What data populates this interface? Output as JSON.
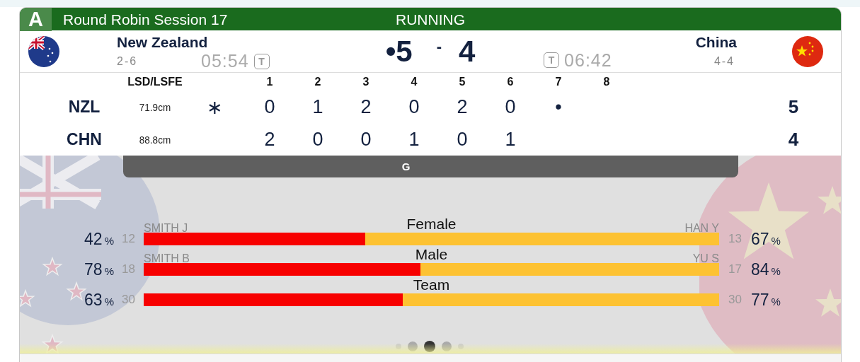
{
  "header": {
    "badge": "A",
    "title": "Round Robin Session 17",
    "status": "RUNNING"
  },
  "teams": [
    {
      "name": "New Zealand",
      "record": "2-6",
      "timer": "05:54",
      "timer_badge": "T"
    },
    {
      "name": "China",
      "record": "4-4",
      "timer": "06:42",
      "timer_badge": "T"
    }
  ],
  "score": {
    "home": "•5",
    "separator": "-",
    "away": "4"
  },
  "scoreboard": {
    "columns": [
      "LSD/LSFE",
      "1",
      "2",
      "3",
      "4",
      "5",
      "6",
      "7",
      "8"
    ],
    "rows": [
      {
        "code": "NZL",
        "lsd": "71.9cm",
        "hammer": "∗",
        "ends": [
          "0",
          "1",
          "2",
          "0",
          "2",
          "0",
          "•"
        ],
        "total": "5"
      },
      {
        "code": "CHN",
        "lsd": "88.8cm",
        "ends": [
          "2",
          "0",
          "0",
          "1",
          "0",
          "1"
        ],
        "total": "4"
      }
    ]
  },
  "tab_bar": {
    "label": "G"
  },
  "stats": [
    {
      "label": "Female",
      "left": {
        "player": "SMITH J",
        "count": "12",
        "pct": "42",
        "unit": "%"
      },
      "right": {
        "player": "HAN Y",
        "count": "13",
        "pct": "67",
        "unit": "%"
      },
      "level": 0.385
    },
    {
      "label": "Male",
      "left": {
        "player": "SMITH B",
        "count": "18",
        "pct": "78",
        "unit": "%"
      },
      "right": {
        "player": "YU S",
        "count": "17",
        "pct": "84",
        "unit": "%"
      },
      "level": 0.481
    },
    {
      "label": "Team",
      "left": {
        "count": "30",
        "pct": "63",
        "unit": "%"
      },
      "right": {
        "count": "30",
        "pct": "77",
        "unit": "%"
      },
      "level": 0.45
    }
  ],
  "pager": [
    {
      "selected": false
    },
    {
      "selected": false
    },
    {
      "selected": true
    },
    {
      "selected": false
    },
    {
      "selected": false
    }
  ]
}
